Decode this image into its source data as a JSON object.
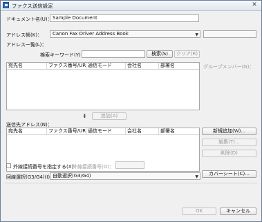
{
  "window": {
    "title": "ファクス送信設定",
    "close_glyph": "✕"
  },
  "document": {
    "label": "ドキュメント名(U)：",
    "value": "Sample Document"
  },
  "address_book": {
    "label": "アドレス帳(K)：",
    "selected": "Canon Fax Driver Address Book"
  },
  "address_list": {
    "label": "アドレス一覧(L)：",
    "search_label": "検索キーワード(Y)：",
    "search_value": "",
    "search_button": "検索(S)",
    "clear_button": "クリア(R)",
    "columns": [
      "宛先名",
      "ファクス番号/URI",
      "通信モード",
      "会社名",
      "部署名"
    ]
  },
  "group_member": {
    "label": "グループメンバー(G)："
  },
  "add_button": "追加(A)",
  "recipients": {
    "label": "送信先アドレス(N)：",
    "columns": [
      "宛先名",
      "ファクス番号/URI",
      "通信モード",
      "会社名",
      "部署名"
    ]
  },
  "side_buttons": {
    "new_add": "新規追加(W)...",
    "edit": "編集(T)...",
    "delete": "削除(D)",
    "cover_sheet": "カバーシート(C)..."
  },
  "outside_line": {
    "checkbox_label": "外線接続番号を指定する(X)",
    "number_label": "外線接続番号(O)：",
    "number_value": ""
  },
  "line_select": {
    "label": "回線選択(G3/G4)(I)：",
    "selected": "自動選択(G3/G4)"
  },
  "footer": {
    "ok": "OK",
    "cancel": "キャンセル"
  }
}
